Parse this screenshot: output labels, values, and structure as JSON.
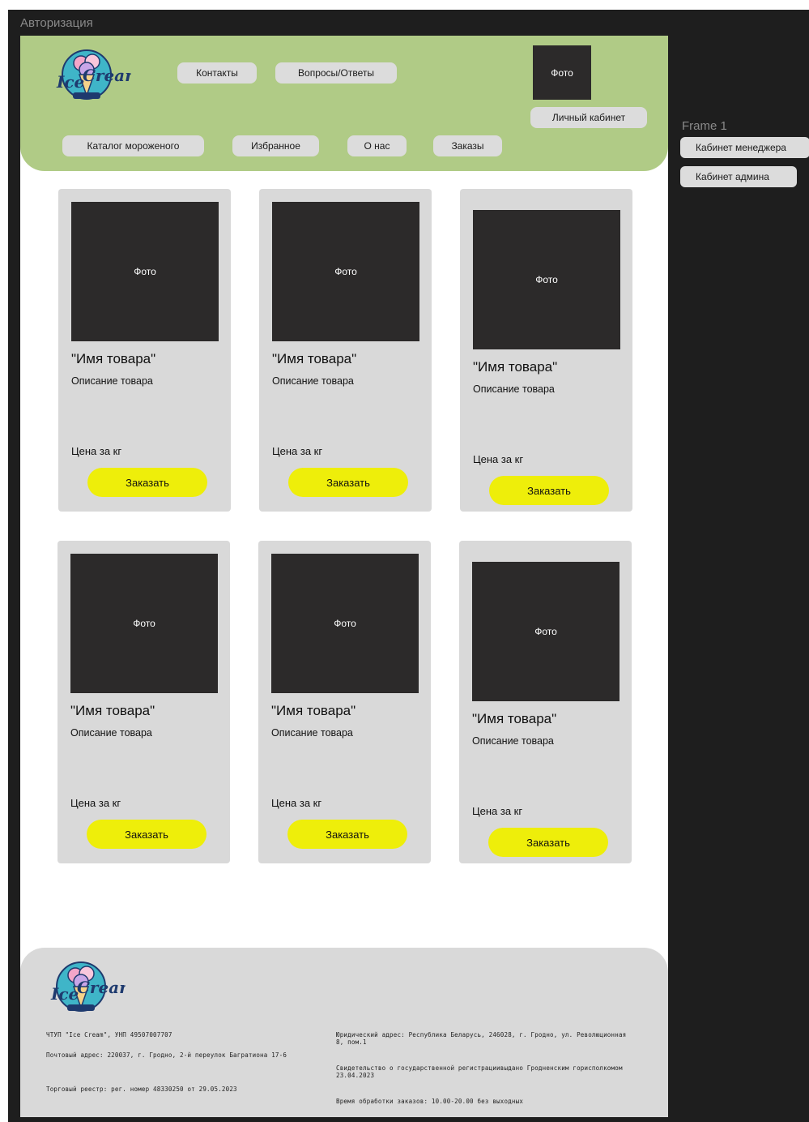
{
  "canvas": {
    "frame_title": "Авторизация",
    "side_frame_title": "Frame 1",
    "side_buttons": [
      "Кабинет менеджера",
      "Кабинет админа"
    ]
  },
  "header": {
    "logo_alt": "Ice Cream",
    "nav_top": [
      "Контакты",
      "Вопросы/Ответы"
    ],
    "photo_label": "Фото",
    "account_button": "Личный кабинет",
    "nav_bottom": [
      "Каталог мороженого",
      "Избранное",
      "О нас",
      "Заказы"
    ]
  },
  "products": [
    {
      "photo": "Фото",
      "name": "\"Имя товара\"",
      "description": "Описание товара",
      "price": "Цена за кг",
      "order": "Заказать"
    },
    {
      "photo": "Фото",
      "name": "\"Имя товара\"",
      "description": "Описание товара",
      "price": "Цена за кг",
      "order": "Заказать"
    },
    {
      "photo": "Фото",
      "name": "\"Имя товара\"",
      "description": "Описание товара",
      "price": "Цена за кг",
      "order": "Заказать"
    },
    {
      "photo": "Фото",
      "name": "\"Имя товара\"",
      "description": "Описание товара",
      "price": "Цена за кг",
      "order": "Заказать"
    },
    {
      "photo": "Фото",
      "name": "\"Имя товара\"",
      "description": "Описание товара",
      "price": "Цена за кг",
      "order": "Заказать"
    },
    {
      "photo": "Фото",
      "name": "\"Имя товара\"",
      "description": "Описание товара",
      "price": "Цена за кг",
      "order": "Заказать"
    }
  ],
  "footer": {
    "company": "ЧТУП \"Ice Cream\", УНП 49507007707",
    "postal": "Почтовый адрес: 220037, г. Гродно, 2-й переулок Багратиона 17-6",
    "trade_register": "Торговый реестр: рег. номер 48330250 от 29.05.2023",
    "legal": "Юридический адрес: Республика Беларусь, 246028, г. Гродно, ул. Революционная 8, пом.1",
    "certificate": "Свидетельство о государственной регистрациивыдано Гродненским горисполкомом 23.04.2023",
    "hours": "Время обработки заказов: 10.00-20.00 без выходных"
  },
  "colors": {
    "header_green": "#b0cb86",
    "order_yellow": "#eeee0a",
    "card_grey": "#d9d9d9",
    "photo_dark": "#2c2a2a",
    "logo_teal": "#3fb5c8"
  }
}
